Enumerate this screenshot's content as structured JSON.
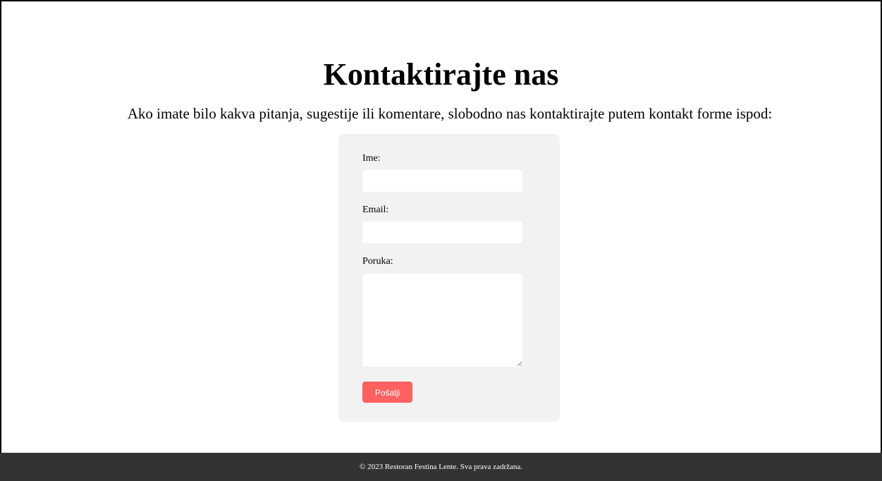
{
  "page": {
    "title": "Kontaktirajte nas",
    "intro": "Ako imate bilo kakva pitanja, sugestije ili komentare, slobodno nas kontaktirajte putem kontakt forme ispod:"
  },
  "form": {
    "name_label": "Ime:",
    "name_value": "",
    "email_label": "Email:",
    "email_value": "",
    "message_label": "Poruka:",
    "message_value": "",
    "submit_label": "Pošalji"
  },
  "footer": {
    "text": "© 2023 Restoran Festina Lente. Sva prava zadržana."
  },
  "colors": {
    "accent": "#ff6060",
    "form_background": "#f2f2f2",
    "footer_background": "#333333"
  }
}
